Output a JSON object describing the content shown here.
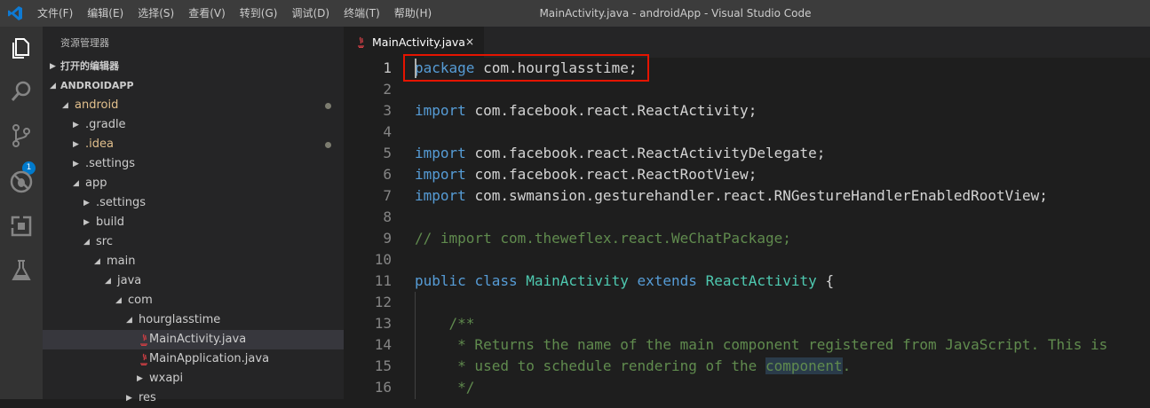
{
  "titlebar": {
    "menu": [
      "文件(F)",
      "编辑(E)",
      "选择(S)",
      "查看(V)",
      "转到(G)",
      "调试(D)",
      "终端(T)",
      "帮助(H)"
    ],
    "window_title": "MainActivity.java - androidApp - Visual Studio Code"
  },
  "activitybar": {
    "icons": [
      "explorer-icon",
      "search-icon",
      "source-control-icon",
      "debug-icon",
      "extensions-icon",
      "test-icon"
    ],
    "scm_badge": "1"
  },
  "sidebar": {
    "title": "资源管理器",
    "open_editors": "打开的编辑器",
    "project": "ANDROIDAPP",
    "tree": [
      {
        "label": "android",
        "depth": 0,
        "expanded": true,
        "modified": true,
        "color": "#e2c08d"
      },
      {
        "label": ".gradle",
        "depth": 1,
        "expanded": false
      },
      {
        "label": ".idea",
        "depth": 1,
        "expanded": false,
        "modified": true,
        "color": "#e2c08d"
      },
      {
        "label": ".settings",
        "depth": 1,
        "expanded": false
      },
      {
        "label": "app",
        "depth": 1,
        "expanded": true
      },
      {
        "label": ".settings",
        "depth": 2,
        "expanded": false
      },
      {
        "label": "build",
        "depth": 2,
        "expanded": false
      },
      {
        "label": "src",
        "depth": 2,
        "expanded": true
      },
      {
        "label": "main",
        "depth": 3,
        "expanded": true
      },
      {
        "label": "java",
        "depth": 4,
        "expanded": true
      },
      {
        "label": "com",
        "depth": 5,
        "expanded": true
      },
      {
        "label": "hourglasstime",
        "depth": 6,
        "expanded": true
      },
      {
        "label": "MainActivity.java",
        "depth": 7,
        "file": true,
        "selected": true
      },
      {
        "label": "MainApplication.java",
        "depth": 7,
        "file": true
      },
      {
        "label": "wxapi",
        "depth": 7,
        "expanded": false
      },
      {
        "label": "res",
        "depth": 6,
        "expanded": false
      }
    ]
  },
  "editor": {
    "tab": {
      "label": "MainActivity.java",
      "close": "×"
    },
    "lines": [
      {
        "n": "1",
        "tokens": [
          [
            "kw",
            "package"
          ],
          [
            "",
            "com.hourglasstime;"
          ]
        ]
      },
      {
        "n": "2",
        "tokens": []
      },
      {
        "n": "3",
        "tokens": [
          [
            "kw",
            "import"
          ],
          [
            "",
            "com.facebook.react.ReactActivity;"
          ]
        ]
      },
      {
        "n": "4",
        "tokens": []
      },
      {
        "n": "5",
        "tokens": [
          [
            "kw",
            "import"
          ],
          [
            "",
            "com.facebook.react.ReactActivityDelegate;"
          ]
        ]
      },
      {
        "n": "6",
        "tokens": [
          [
            "kw",
            "import"
          ],
          [
            "",
            "com.facebook.react.ReactRootView;"
          ]
        ]
      },
      {
        "n": "7",
        "tokens": [
          [
            "kw",
            "import"
          ],
          [
            "",
            "com.swmansion.gesturehandler.react.RNGestureHandlerEnabledRootView;"
          ]
        ]
      },
      {
        "n": "8",
        "tokens": []
      },
      {
        "n": "9",
        "tokens": [
          [
            "cmt",
            "// import com.theweflex.react.WeChatPackage;"
          ]
        ]
      },
      {
        "n": "10",
        "tokens": []
      },
      {
        "n": "11",
        "tokens": [
          [
            "kw",
            "public"
          ],
          [
            "kw",
            "class"
          ],
          [
            "cls",
            "MainActivity"
          ],
          [
            "kw",
            "extends"
          ],
          [
            "cls",
            "ReactActivity"
          ],
          [
            "",
            "{"
          ]
        ]
      },
      {
        "n": "12",
        "tokens": []
      },
      {
        "n": "13",
        "tokens": [
          [
            "cmt",
            "    /**"
          ]
        ]
      },
      {
        "n": "14",
        "tokens": [
          [
            "cmt",
            "     * Returns the name of the main component registered from JavaScript. This is"
          ]
        ]
      },
      {
        "n": "15",
        "tokens": [
          [
            "cmt",
            "     * used to schedule rendering of the "
          ],
          [
            "cmt-hl",
            "component"
          ],
          [
            "cmt",
            "."
          ]
        ]
      },
      {
        "n": "16",
        "tokens": [
          [
            "cmt",
            "     */"
          ]
        ]
      }
    ]
  }
}
